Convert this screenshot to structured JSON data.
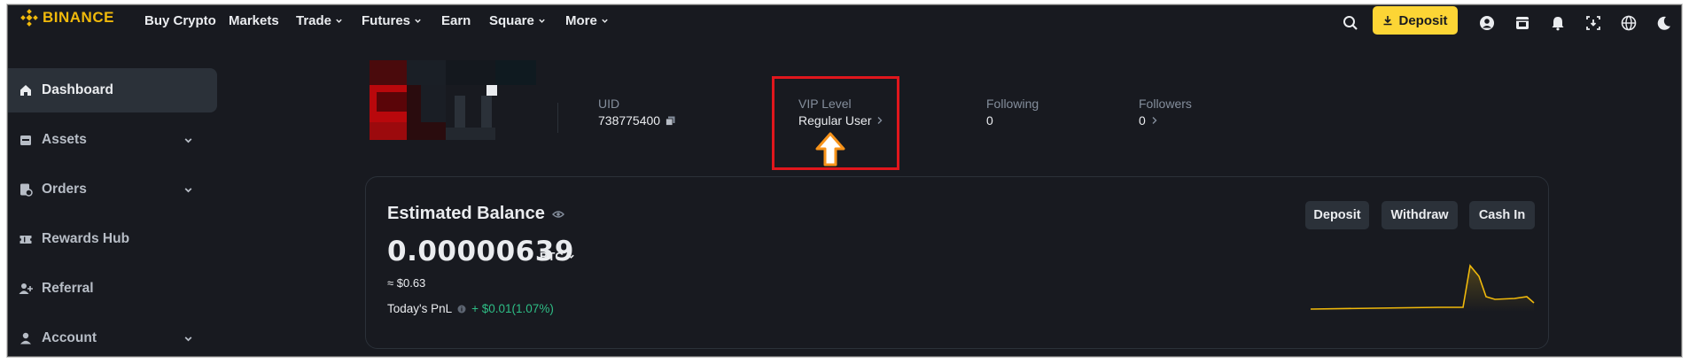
{
  "brand": {
    "name": "BINANCE",
    "color": "#f0b90b"
  },
  "topnav": {
    "items": [
      {
        "label": "Buy Crypto",
        "dropdown": false
      },
      {
        "label": "Markets",
        "dropdown": false
      },
      {
        "label": "Trade",
        "dropdown": true
      },
      {
        "label": "Futures",
        "dropdown": true
      },
      {
        "label": "Earn",
        "dropdown": false
      },
      {
        "label": "Square",
        "dropdown": true
      },
      {
        "label": "More",
        "dropdown": true
      }
    ],
    "deposit_label": "Deposit",
    "icons": [
      "search-icon",
      "download-icon",
      "user-icon",
      "wallet-icon",
      "bell-icon",
      "app-download-icon",
      "globe-icon",
      "theme-moon-icon"
    ]
  },
  "sidebar": {
    "items": [
      {
        "label": "Dashboard",
        "icon": "home-icon",
        "active": true,
        "expandable": false
      },
      {
        "label": "Assets",
        "icon": "assets-icon",
        "active": false,
        "expandable": true
      },
      {
        "label": "Orders",
        "icon": "orders-icon",
        "active": false,
        "expandable": true
      },
      {
        "label": "Rewards Hub",
        "icon": "ticket-icon",
        "active": false,
        "expandable": false
      },
      {
        "label": "Referral",
        "icon": "add-user-icon",
        "active": false,
        "expandable": false
      },
      {
        "label": "Account",
        "icon": "account-icon",
        "active": false,
        "expandable": true
      }
    ]
  },
  "profile": {
    "uid_label": "UID",
    "uid_value": "738775400",
    "vip_label": "VIP Level",
    "vip_value": "Regular User",
    "following_label": "Following",
    "following_value": "0",
    "followers_label": "Followers",
    "followers_value": "0"
  },
  "balance": {
    "title": "Estimated Balance",
    "amount": "0.00000639",
    "unit": "BTC",
    "fiat": "≈ $0.63",
    "pnl_label": "Today's PnL",
    "pnl_value": "+ $0.01(1.07%)",
    "buttons": {
      "deposit": "Deposit",
      "withdraw": "Withdraw",
      "cash_in": "Cash In"
    }
  },
  "colors": {
    "bg": "#181a20",
    "surface": "#2b3139",
    "accent": "#fcd535",
    "positive": "#2ebd85",
    "annotation": "#e0161c",
    "annotation_arrow": "#f7931a"
  }
}
